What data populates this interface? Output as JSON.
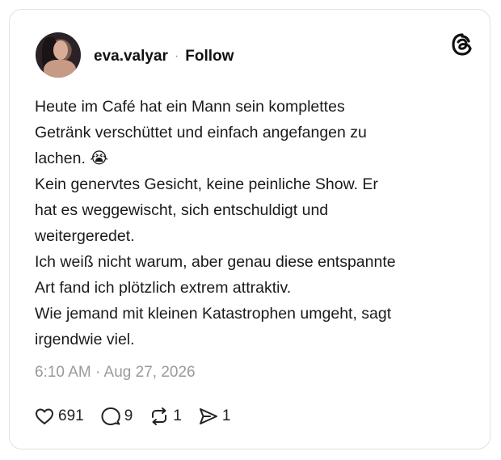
{
  "post": {
    "username": "eva.valyar",
    "separator": "·",
    "follow_label": "Follow",
    "text": "Heute im Café hat ein Mann sein komplettes\nGetränk verschüttet und einfach angefangen zu\nlachen. 😭\nKein genervtes Gesicht, keine peinliche Show. Er\nhat es weggewischt, sich entschuldigt und\nweitergeredet.\nIch weiß nicht warum, aber genau diese entspannte\nArt fand ich plötzlich extrem attraktiv.\nWie jemand mit kleinen Katastrophen umgeht, sagt\nirgendwie viel.",
    "timestamp": "6:10 AM · Aug 27, 2026"
  },
  "actions": {
    "likes": "691",
    "replies": "9",
    "reposts": "1",
    "shares": "1"
  },
  "icons": {
    "brand": "threads-logo-icon",
    "like": "heart-icon",
    "reply": "comment-bubble-icon",
    "repost": "repost-arrows-icon",
    "share": "send-icon"
  }
}
